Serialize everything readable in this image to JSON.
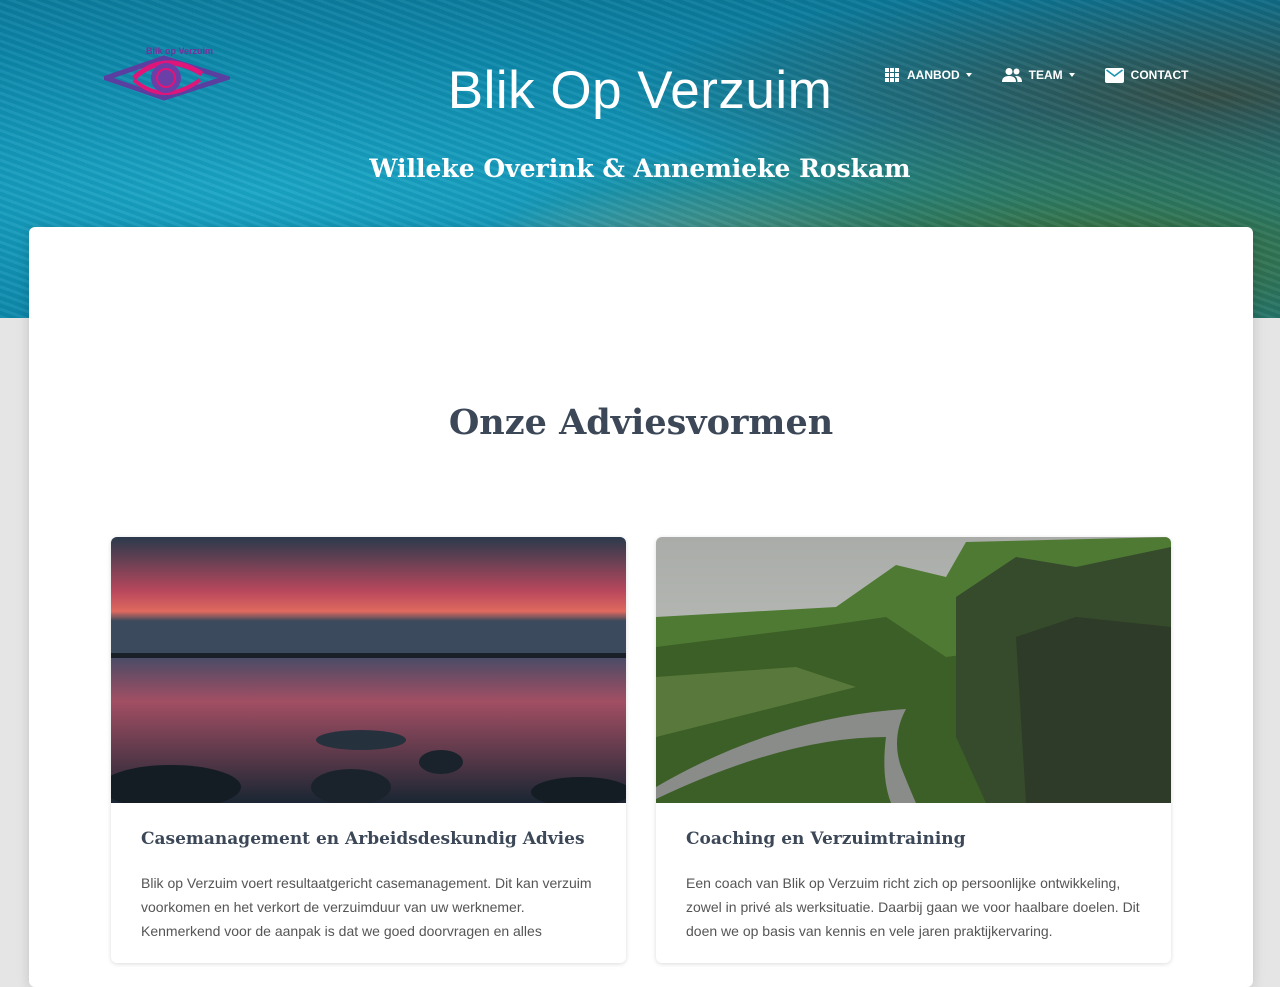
{
  "header": {
    "site_title": "Blik Op Verzuim",
    "subtitle": "Willeke Overink & Annemieke Roskam",
    "logo_text": "Blik op Verzuim"
  },
  "nav": {
    "items": [
      {
        "label": "AANBOD",
        "icon": "grid-icon",
        "dropdown": true
      },
      {
        "label": "TEAM",
        "icon": "people-icon",
        "dropdown": true
      },
      {
        "label": "CONTACT",
        "icon": "mail-icon",
        "dropdown": false
      }
    ]
  },
  "main": {
    "section_title": "Onze Adviesvormen",
    "cards": [
      {
        "title": "Casemanagement en Arbeidsdeskundig Advies",
        "text": "Blik op Verzuim voert resultaatgericht casemanagement. Dit kan verzuim voorkomen en het verkort de verzuimduur van uw werknemer. Kenmerkend voor de aanpak is dat we goed doorvragen en alles"
      },
      {
        "title": "Coaching en Verzuimtraining",
        "text": "Een coach van Blik op Verzuim richt zich op persoonlijke ontwikkeling, zowel in privé als werksituatie. Daarbij gaan we voor haalbare doelen. Dit doen we op basis van kennis en vele jaren praktijkervaring."
      }
    ]
  },
  "colors": {
    "heading": "#3c4858",
    "logo_pink": "#e0157a",
    "logo_purple": "#5b3fa0"
  }
}
